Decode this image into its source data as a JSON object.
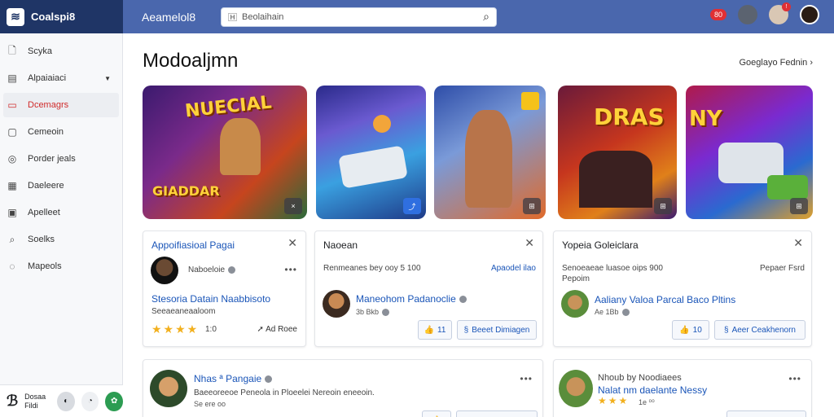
{
  "app": {
    "brand": "Coalspi8",
    "title": "Aeamelol8"
  },
  "search": {
    "placeholder": "Beolaihain"
  },
  "topbar": {
    "notification_count": "80",
    "profile_badge": "!"
  },
  "sidebar": {
    "items": [
      {
        "label": "Scyka",
        "icon": "document-icon"
      },
      {
        "label": "Alpaiaiaci",
        "icon": "card-icon",
        "has_caret": true
      },
      {
        "label": "Dcemagrs",
        "icon": "inbox-icon",
        "active": true
      },
      {
        "label": "Cemeoin",
        "icon": "image-icon"
      },
      {
        "label": "Porder jeals",
        "icon": "target-icon"
      },
      {
        "label": "Daeleere",
        "icon": "grid-icon"
      },
      {
        "label": "Apelleet",
        "icon": "clipboard-icon"
      },
      {
        "label": "Soelks",
        "icon": "search-icon"
      },
      {
        "label": "Mapeols",
        "icon": "chat-icon"
      }
    ],
    "footer": {
      "line1": "Dosaa",
      "line2": "Fildi"
    }
  },
  "main": {
    "title": "Modoaljmn",
    "link": "Goeglayo Fednin ›"
  },
  "tiles": [
    {
      "text": "NUECIAL",
      "sub": "GIADDAR",
      "badge": "×",
      "colors": [
        "#3a1a6e",
        "#c6451e"
      ]
    },
    {
      "text": "",
      "sub": "",
      "badge": "⤴",
      "colors": [
        "#1e3a88",
        "#3aa0e0"
      ]
    },
    {
      "text": "",
      "sub": "",
      "badge": "⊞",
      "colors": [
        "#2e4da8",
        "#e06a2a"
      ]
    },
    {
      "text": "DRAS",
      "sub": "",
      "badge": "⊞",
      "colors": [
        "#6a1a3a",
        "#e05a1a"
      ]
    },
    {
      "text": "NY",
      "sub": "",
      "badge": "⊞",
      "colors": [
        "#b01a4a",
        "#2a6ad0"
      ]
    }
  ],
  "cards": [
    {
      "title": "Appoifiasioal Pagai",
      "author": "Naboeloie",
      "headline": "Stesoria Datain Naabbisoto",
      "subline": "Seeaeaneaaloom",
      "rating": "1:0",
      "action": "Ad Roee"
    },
    {
      "title": "Naoean",
      "sub": "Renmeanes bey ooy 5 100",
      "link": "Apaodel ilao",
      "author": "Maneohom Padanoclie",
      "meta": "3b Bkb",
      "like_count": "11",
      "button": "Beeet Dimiagen"
    },
    {
      "title": "Yopeia Goleiclara",
      "sub": "Senoeaeae luasoe oips 900",
      "sub2": "Pepoim",
      "link": "Pepaer Fsrd",
      "author": "Aaliany Valoa Parcal Baco Pltins",
      "meta": "Ae 1Bb",
      "like_count": "10",
      "button": "Aeer Ceakhenorn"
    },
    {
      "author": "Nhas ª Pangaie",
      "text": "Baeeoreeoe Peneola in Ploeelei Nereoin eneeoin.",
      "meta": "Se ere oo"
    },
    {
      "author": "Nhoub by Noodiaees",
      "headline": "Nalat nm daelante Nessy",
      "meta": "1e ⁰⁰"
    }
  ]
}
